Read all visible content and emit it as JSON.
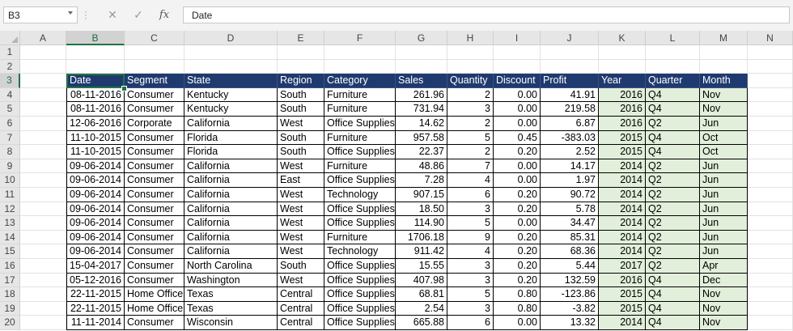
{
  "formula_bar": {
    "name_box": "B3",
    "cancel_symbol": "✕",
    "enter_symbol": "✓",
    "fx_label": "fx",
    "formula": "Date"
  },
  "columns": [
    "A",
    "B",
    "C",
    "D",
    "E",
    "F",
    "G",
    "H",
    "I",
    "J",
    "K",
    "L",
    "M",
    "N"
  ],
  "rows": [
    "1",
    "2",
    "3",
    "4",
    "5",
    "6",
    "7",
    "8",
    "9",
    "10",
    "11",
    "12",
    "13",
    "14",
    "15",
    "16",
    "17",
    "18",
    "19",
    "20"
  ],
  "table": {
    "headers": [
      "Date",
      "Segment",
      "State",
      "Region",
      "Category",
      "Sales",
      "Quantity",
      "Discount",
      "Profit",
      "Year",
      "Quarter",
      "Month"
    ],
    "data": [
      [
        "08-11-2016",
        "Consumer",
        "Kentucky",
        "South",
        "Furniture",
        "261.96",
        "2",
        "0.00",
        "41.91",
        "2016",
        "Q4",
        "Nov"
      ],
      [
        "08-11-2016",
        "Consumer",
        "Kentucky",
        "South",
        "Furniture",
        "731.94",
        "3",
        "0.00",
        "219.58",
        "2016",
        "Q4",
        "Nov"
      ],
      [
        "12-06-2016",
        "Corporate",
        "California",
        "West",
        "Office Supplies",
        "14.62",
        "2",
        "0.00",
        "6.87",
        "2016",
        "Q2",
        "Jun"
      ],
      [
        "11-10-2015",
        "Consumer",
        "Florida",
        "South",
        "Furniture",
        "957.58",
        "5",
        "0.45",
        "-383.03",
        "2015",
        "Q4",
        "Oct"
      ],
      [
        "11-10-2015",
        "Consumer",
        "Florida",
        "South",
        "Office Supplies",
        "22.37",
        "2",
        "0.20",
        "2.52",
        "2015",
        "Q4",
        "Oct"
      ],
      [
        "09-06-2014",
        "Consumer",
        "California",
        "West",
        "Furniture",
        "48.86",
        "7",
        "0.00",
        "14.17",
        "2014",
        "Q2",
        "Jun"
      ],
      [
        "09-06-2014",
        "Consumer",
        "California",
        "East",
        "Office Supplies",
        "7.28",
        "4",
        "0.00",
        "1.97",
        "2014",
        "Q2",
        "Jun"
      ],
      [
        "09-06-2014",
        "Consumer",
        "California",
        "West",
        "Technology",
        "907.15",
        "6",
        "0.20",
        "90.72",
        "2014",
        "Q2",
        "Jun"
      ],
      [
        "09-06-2014",
        "Consumer",
        "California",
        "West",
        "Office Supplies",
        "18.50",
        "3",
        "0.20",
        "5.78",
        "2014",
        "Q2",
        "Jun"
      ],
      [
        "09-06-2014",
        "Consumer",
        "California",
        "West",
        "Office Supplies",
        "114.90",
        "5",
        "0.00",
        "34.47",
        "2014",
        "Q2",
        "Jun"
      ],
      [
        "09-06-2014",
        "Consumer",
        "California",
        "West",
        "Furniture",
        "1706.18",
        "9",
        "0.20",
        "85.31",
        "2014",
        "Q2",
        "Jun"
      ],
      [
        "09-06-2014",
        "Consumer",
        "California",
        "West",
        "Technology",
        "911.42",
        "4",
        "0.20",
        "68.36",
        "2014",
        "Q2",
        "Jun"
      ],
      [
        "15-04-2017",
        "Consumer",
        "North Carolina",
        "South",
        "Office Supplies",
        "15.55",
        "3",
        "0.20",
        "5.44",
        "2017",
        "Q2",
        "Apr"
      ],
      [
        "05-12-2016",
        "Consumer",
        "Washington",
        "West",
        "Office Supplies",
        "407.98",
        "3",
        "0.20",
        "132.59",
        "2016",
        "Q4",
        "Dec"
      ],
      [
        "22-11-2015",
        "Home Office",
        "Texas",
        "Central",
        "Office Supplies",
        "68.81",
        "5",
        "0.80",
        "-123.86",
        "2015",
        "Q4",
        "Nov"
      ],
      [
        "22-11-2015",
        "Home Office",
        "Texas",
        "Central",
        "Office Supplies",
        "2.54",
        "3",
        "0.80",
        "-3.82",
        "2015",
        "Q4",
        "Nov"
      ],
      [
        "11-11-2014",
        "Consumer",
        "Wisconsin",
        "Central",
        "Office Supplies",
        "665.88",
        "6",
        "0.00",
        "13.32",
        "2014",
        "Q4",
        "Nov"
      ]
    ]
  },
  "colors": {
    "header_bg": "#1f3a6e",
    "derived_bg": "#e2efda",
    "selection": "#217346"
  }
}
